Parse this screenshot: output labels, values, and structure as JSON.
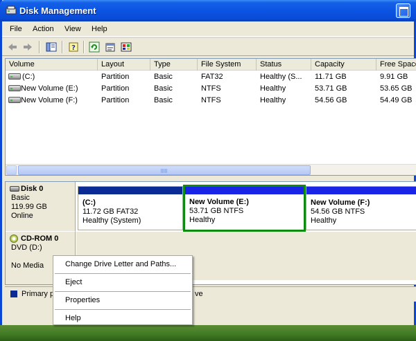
{
  "window": {
    "title": "Disk Management"
  },
  "menubar": [
    "File",
    "Action",
    "View",
    "Help"
  ],
  "toolbar": {
    "icons": [
      "back-arrow-icon",
      "forward-arrow-icon",
      "show-hide-console-tree-icon",
      "help-icon",
      "refresh-icon",
      "properties-icon",
      "rescan-disks-icon"
    ]
  },
  "volume_list": {
    "columns": [
      "Volume",
      "Layout",
      "Type",
      "File System",
      "Status",
      "Capacity",
      "Free Space"
    ],
    "rows": [
      {
        "volume": " (C:)",
        "layout": "Partition",
        "type": "Basic",
        "fs": "FAT32",
        "status": "Healthy (S...",
        "capacity": "11.71 GB",
        "free": "9.91 GB"
      },
      {
        "volume": "New Volume (E:)",
        "layout": "Partition",
        "type": "Basic",
        "fs": "NTFS",
        "status": "Healthy",
        "capacity": "53.71 GB",
        "free": "53.65 GB"
      },
      {
        "volume": "New Volume (F:)",
        "layout": "Partition",
        "type": "Basic",
        "fs": "NTFS",
        "status": "Healthy",
        "capacity": "54.56 GB",
        "free": "54.49 GB"
      }
    ]
  },
  "disks": [
    {
      "name": "Disk 0",
      "type": "Basic",
      "size": "119.99 GB",
      "state": "Online",
      "partitions": [
        {
          "title": "(C:)",
          "detail": "11.72 GB FAT32",
          "status": "Healthy (System)",
          "bar_color": "#0a2b94",
          "selected": false
        },
        {
          "title": "New Volume  (E:)",
          "detail": "53.71 GB NTFS",
          "status": "Healthy",
          "bar_color": "#1a24e6",
          "selected": true
        },
        {
          "title": "New Volume  (F:)",
          "detail": "54.56 GB NTFS",
          "status": "Healthy",
          "bar_color": "#1a24e6",
          "selected": false
        }
      ]
    },
    {
      "name": "CD-ROM 0",
      "type": "DVD (D:)",
      "state": "No Media"
    }
  ],
  "legend": {
    "primary_label": "Primary pa",
    "tail": "ve"
  },
  "context_menu": {
    "items": [
      "Change Drive Letter and Paths...",
      "Eject",
      "Properties",
      "Help"
    ]
  },
  "colors": {
    "selection_border": "#118a11",
    "primary_partition": "#0a2b94",
    "logical_drive": "#1a24e6"
  }
}
